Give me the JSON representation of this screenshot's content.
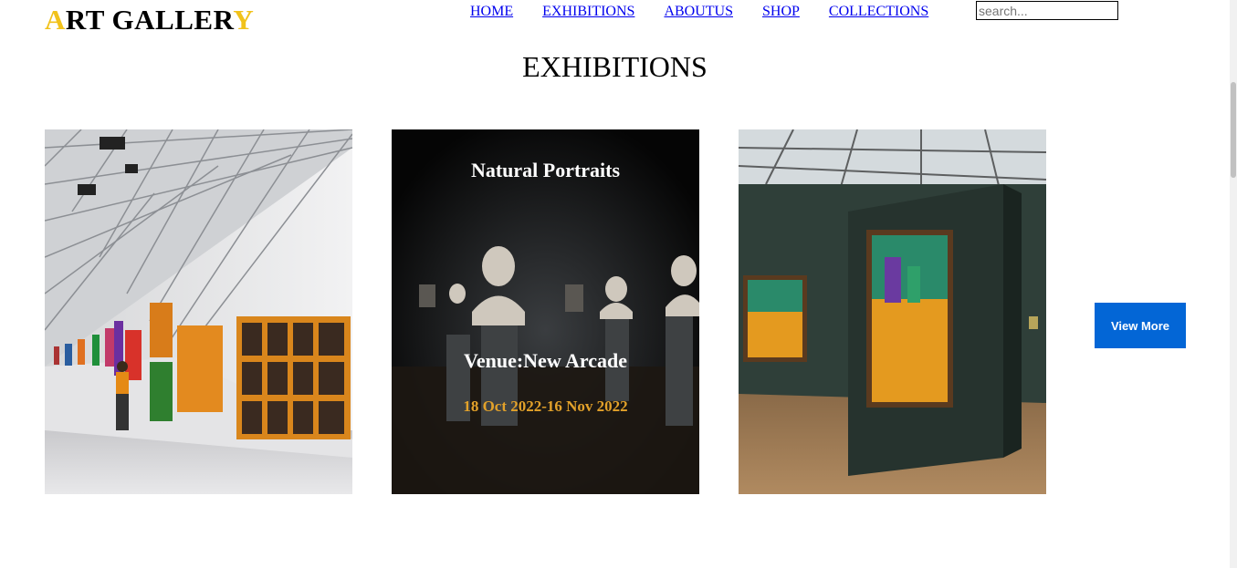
{
  "header": {
    "logo": {
      "first": "A",
      "middle": "RT GALLER",
      "last": "Y"
    },
    "nav": [
      "HOME",
      "EXHIBITIONS",
      "ABOUTUS",
      "SHOP",
      "COLLECTIONS"
    ],
    "search_placeholder": "search..."
  },
  "main": {
    "title": "EXHIBITIONS",
    "featured": {
      "title": "Natural Portraits",
      "venue": "Venue:New Arcade",
      "dates": "18 Oct 2022-16 Nov 2022"
    },
    "view_more_label": "View More"
  },
  "colors": {
    "accent": "#f1c21b",
    "button": "#0366d6",
    "dates": "#e2a12a",
    "link": "#0000ee"
  }
}
